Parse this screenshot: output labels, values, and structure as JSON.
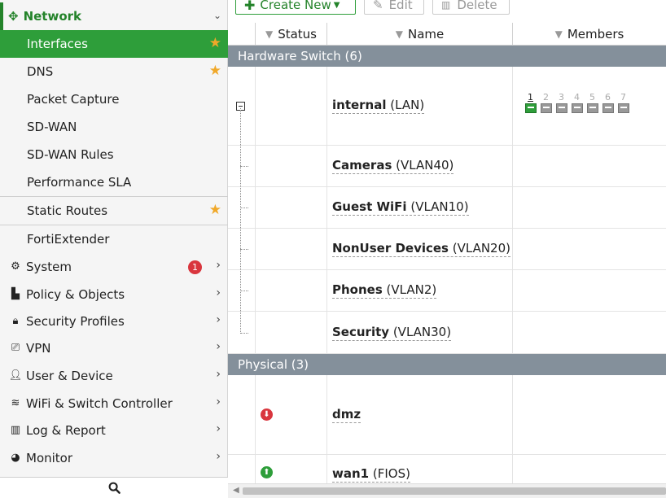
{
  "colors": {
    "brand_green": "#2e9e3a",
    "group_row": "#84909b",
    "star": "#f0a829",
    "badge_red": "#d9363e"
  },
  "sidebar": {
    "section": {
      "label": "Network",
      "icon": "move-arrows-icon",
      "chevron": "chevron-down-icon"
    },
    "sub_items": [
      {
        "label": "Interfaces",
        "active": true,
        "starred": true
      },
      {
        "label": "DNS",
        "active": false,
        "starred": true
      },
      {
        "label": "Packet Capture",
        "active": false,
        "starred": false
      },
      {
        "label": "SD-WAN",
        "active": false,
        "starred": false
      },
      {
        "label": "SD-WAN Rules",
        "active": false,
        "starred": false
      },
      {
        "label": "Performance SLA",
        "active": false,
        "starred": false
      },
      {
        "label": "Static Routes",
        "active": false,
        "starred": true
      },
      {
        "label": "FortiExtender",
        "active": false,
        "starred": false
      }
    ],
    "main_items": [
      {
        "label": "System",
        "icon": "gear-icon",
        "badge": "1"
      },
      {
        "label": "Policy & Objects",
        "icon": "policy-icon"
      },
      {
        "label": "Security Profiles",
        "icon": "lock-icon"
      },
      {
        "label": "VPN",
        "icon": "laptop-icon"
      },
      {
        "label": "User & Device",
        "icon": "user-icon"
      },
      {
        "label": "WiFi & Switch Controller",
        "icon": "wifi-icon"
      },
      {
        "label": "Log & Report",
        "icon": "bar-chart-icon"
      },
      {
        "label": "Monitor",
        "icon": "pie-chart-icon"
      }
    ],
    "search_icon": "search-icon"
  },
  "toolbar": {
    "create_new": "Create New",
    "edit": "Edit",
    "delete": "Delete"
  },
  "table": {
    "columns": {
      "status": "Status",
      "name": "Name",
      "members": "Members"
    },
    "groups": [
      {
        "label": "Hardware Switch (6)",
        "rows": [
          {
            "name": "internal",
            "alias": "(LAN)",
            "ports": [
              "1",
              "2",
              "3",
              "4",
              "5",
              "6",
              "7"
            ],
            "active_port": "1"
          },
          {
            "name": "Cameras",
            "alias": "(VLAN40)"
          },
          {
            "name": "Guest WiFi",
            "alias": "(VLAN10)"
          },
          {
            "name": "NonUser Devices",
            "alias": "(VLAN20)"
          },
          {
            "name": "Phones",
            "alias": "(VLAN2)"
          },
          {
            "name": "Security",
            "alias": "(VLAN30)"
          }
        ]
      },
      {
        "label": "Physical (3)",
        "rows": [
          {
            "name": "dmz",
            "alias": "",
            "status": "down"
          },
          {
            "name": "wan1",
            "alias": "(FIOS)",
            "status": "up"
          }
        ]
      }
    ]
  }
}
